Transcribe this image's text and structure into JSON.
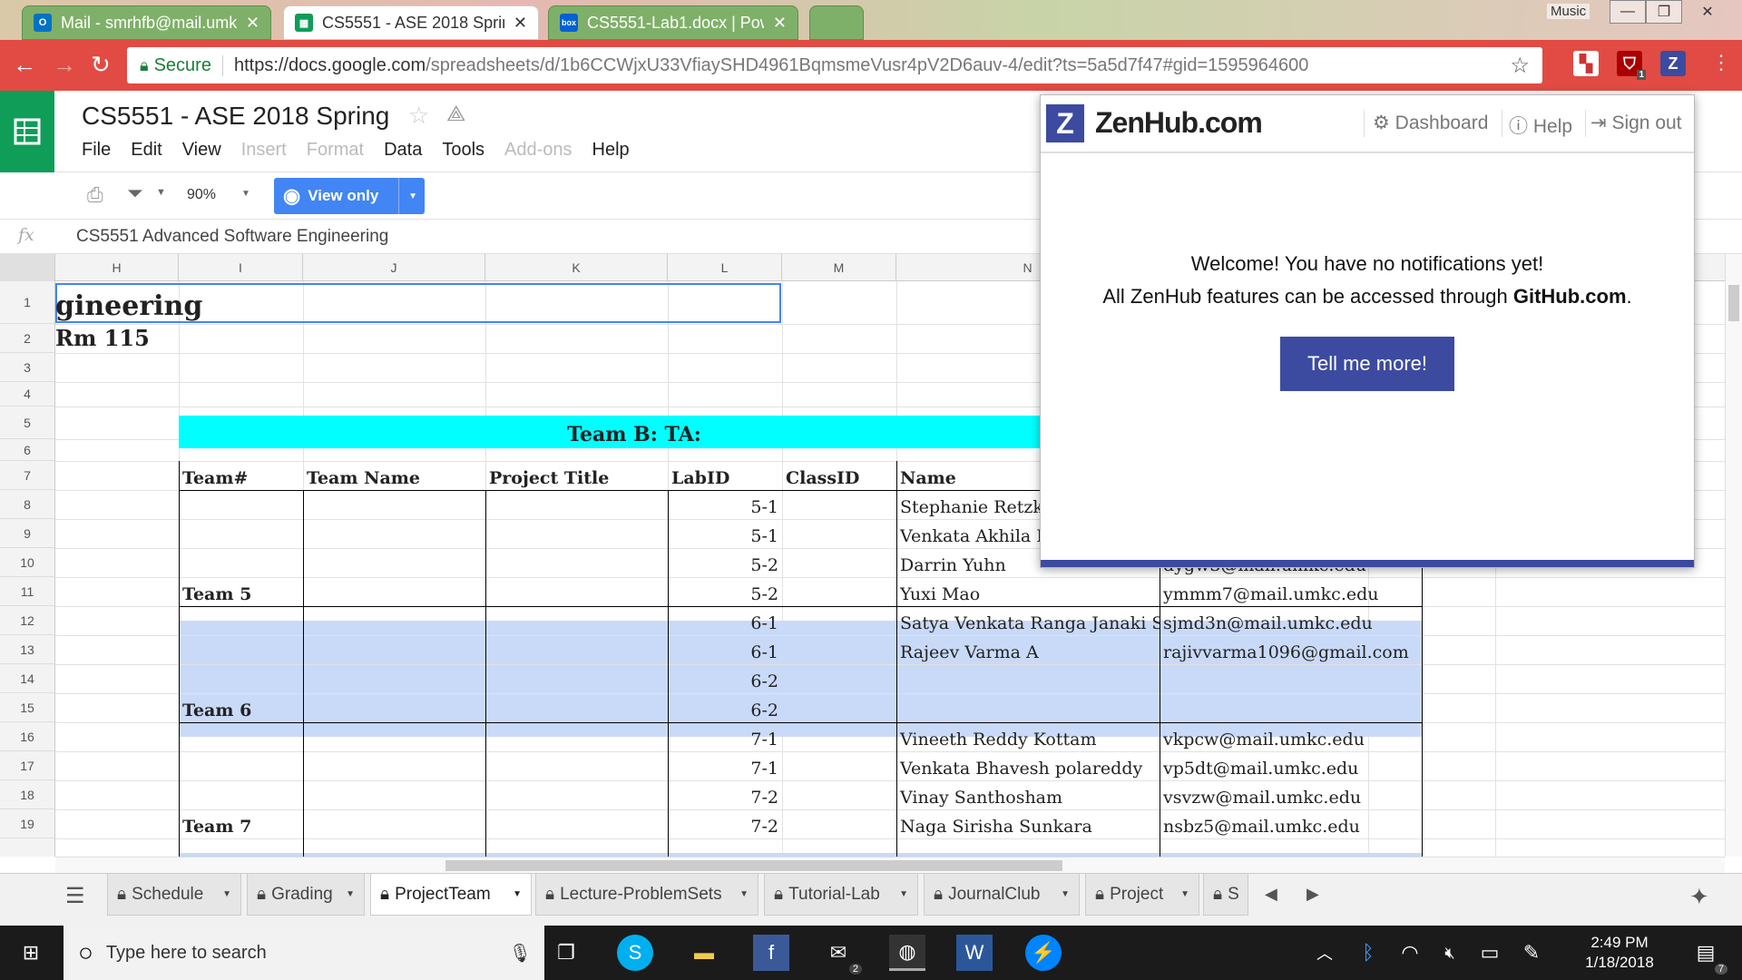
{
  "browser": {
    "tabs": [
      {
        "icon": "O",
        "icon_color": "#0072c6",
        "title": "Mail - smrhfb@mail.umk"
      },
      {
        "icon": "▦",
        "icon_color": "#0f9d58",
        "title": "CS5551 - ASE 2018 Sprin"
      },
      {
        "icon": "box",
        "icon_color": "#0061d5",
        "title": "CS5551-Lab1.docx | Pow"
      }
    ],
    "window_label": "Music",
    "secure_label": "Secure",
    "url_host": "https://docs.google.com",
    "url_path": "/spreadsheets/d/1b6CCWjxU33VfiaySHD4961BqmsmeVusr4pV2D6auv-4/edit?ts=5a5d7f47#gid=1595964600",
    "ext_badge": "1"
  },
  "sheet": {
    "title": "CS5551 - ASE 2018 Spring",
    "menu": [
      "File",
      "Edit",
      "View",
      "Insert",
      "Format",
      "Data",
      "Tools",
      "Add-ons",
      "Help"
    ],
    "menu_disabled": [
      "Insert",
      "Format",
      "Add-ons"
    ],
    "zoom": "90%",
    "view_only_label": "View only",
    "formula_content": "CS5551 Advanced Software Engineering",
    "fx_label": "fx",
    "columns": [
      "H",
      "I",
      "J",
      "K",
      "L",
      "M",
      "N"
    ],
    "rows": [
      "1",
      "2",
      "3",
      "4",
      "5",
      "6",
      "7",
      "8",
      "9",
      "10",
      "11",
      "12",
      "13",
      "14",
      "15",
      "16",
      "17",
      "18",
      "19"
    ],
    "cells": {
      "r1": "gineering",
      "r2": "Rm 115",
      "r5_banner": "Team B:  TA:",
      "headers": [
        "Team#",
        "Team Name",
        "Project Title",
        "LabID",
        "ClassID",
        "Name"
      ],
      "teams": [
        "Team 5",
        "Team 6",
        "Team 7"
      ],
      "labids": [
        "5-1",
        "5-1",
        "5-2",
        "5-2",
        "6-1",
        "6-1",
        "6-2",
        "6-2",
        "7-1",
        "7-1",
        "7-2",
        "7-2"
      ],
      "names": [
        "Stephanie Retzke",
        "Venkata Akhila K",
        "Darrin Yuhn",
        "Yuxi Mao",
        "Satya Venkata Ranga Janaki Si",
        "Rajeev Varma A",
        "",
        "",
        "Vineeth Reddy Kottam",
        "Venkata Bhavesh polareddy",
        "Vinay Santhosham",
        "Naga Sirisha Sunkara"
      ],
      "emails": [
        "",
        "",
        "dygw3@mail.umkc.edu",
        "ymmm7@mail.umkc.edu",
        "sjmd3n@mail.umkc.edu",
        "rajivvarma1096@gmail.com",
        "",
        "",
        "vkpcw@mail.umkc.edu",
        "vp5dt@mail.umkc.edu",
        "vsvzw@mail.umkc.edu",
        "nsbz5@mail.umkc.edu"
      ]
    },
    "sheet_tabs": [
      "Schedule",
      "Grading",
      "ProjectTeam",
      "Lecture-ProblemSets",
      "Tutorial-Lab",
      "JournalClub",
      "Project",
      "S"
    ],
    "active_tab": "ProjectTeam"
  },
  "zenhub": {
    "brand": "ZenHub.com",
    "nav": [
      "Dashboard",
      "Help",
      "Sign out"
    ],
    "message_line1": "Welcome! You have no notifications yet!",
    "message_line2_prefix": "All ZenHub features can be accessed through ",
    "message_line2_link": "GitHub.com",
    "message_line2_suffix": ".",
    "button_label": "Tell me more!",
    "brand_color": "#3c4ba0"
  },
  "taskbar": {
    "search_placeholder": "Type here to search",
    "time": "2:49 PM",
    "date": "1/18/2018",
    "mail_badge": "2",
    "notif_badge": "7"
  }
}
